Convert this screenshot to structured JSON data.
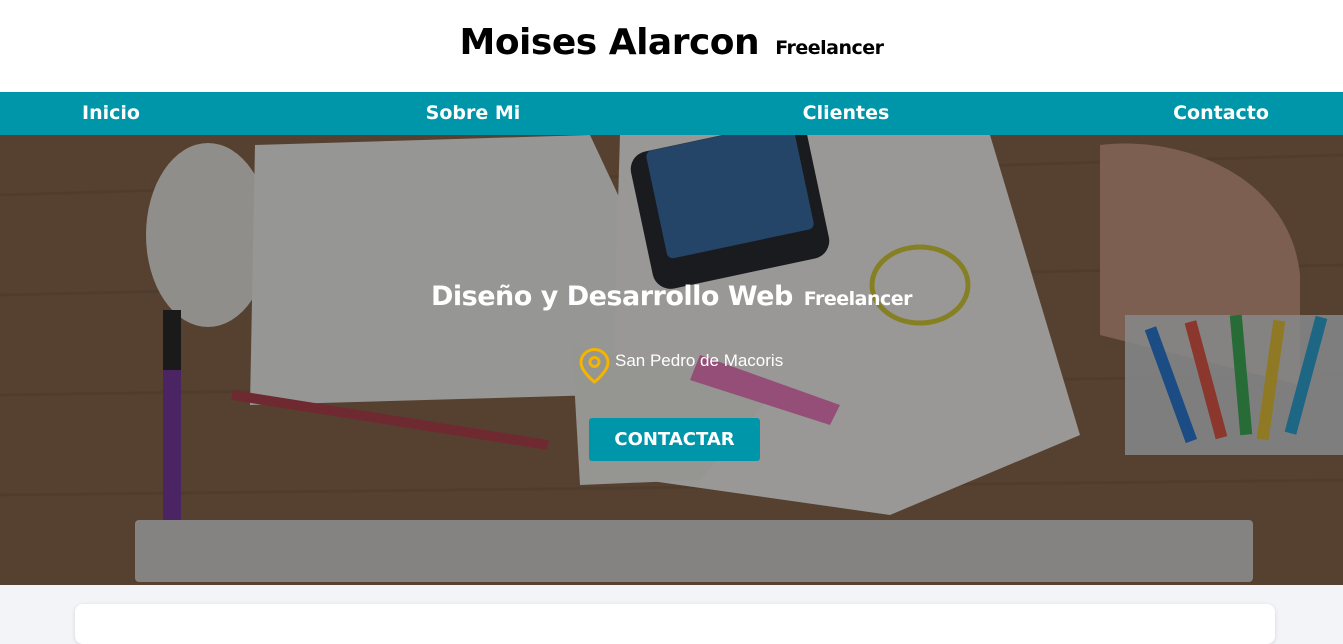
{
  "header": {
    "title": "Moises Alarcon",
    "subtitle": "Freelancer"
  },
  "nav": {
    "items": [
      {
        "label": "Inicio"
      },
      {
        "label": "Sobre Mi"
      },
      {
        "label": "Clientes"
      },
      {
        "label": "Contacto"
      }
    ]
  },
  "hero": {
    "heading": "Diseño y Desarrollo Web",
    "heading_sub": "Freelancer",
    "location_icon": "location-pin-icon",
    "location": "San Pedro de Macoris",
    "cta_label": "CONTACTAR"
  },
  "colors": {
    "accent": "#0096a9",
    "pin": "#f4b400",
    "header_bg": "#ffffff",
    "page_bg": "#f2f4f7"
  }
}
